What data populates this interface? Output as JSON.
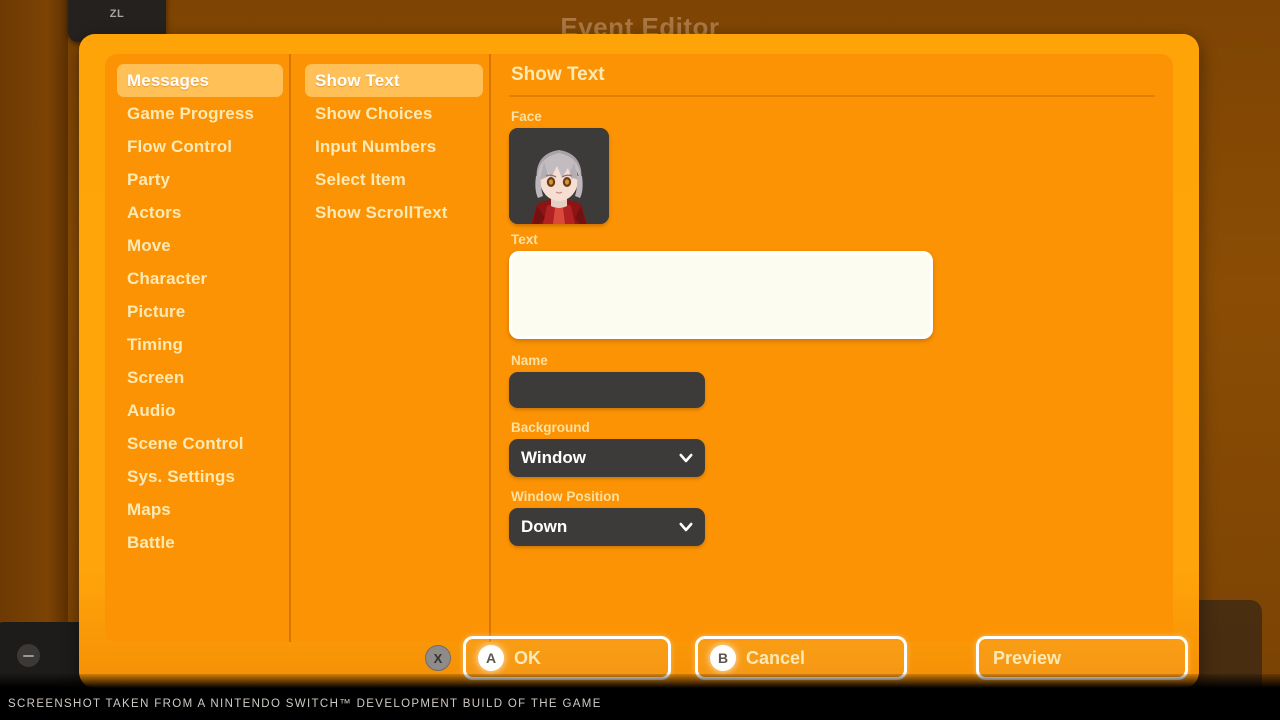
{
  "background": {
    "editor_title": "Event Editor",
    "tab_label": "ZL",
    "minimize_icon": "minus-icon"
  },
  "dialog": {
    "categories": {
      "selected": "Messages",
      "items": [
        {
          "label": "Messages"
        },
        {
          "label": "Game Progress"
        },
        {
          "label": "Flow Control"
        },
        {
          "label": "Party"
        },
        {
          "label": "Actors"
        },
        {
          "label": "Move"
        },
        {
          "label": "Character"
        },
        {
          "label": "Picture"
        },
        {
          "label": "Timing"
        },
        {
          "label": "Screen"
        },
        {
          "label": "Audio"
        },
        {
          "label": "Scene Control"
        },
        {
          "label": "Sys. Settings"
        },
        {
          "label": "Maps"
        },
        {
          "label": "Battle"
        }
      ]
    },
    "commands": {
      "selected": "Show Text",
      "items": [
        {
          "label": "Show Text"
        },
        {
          "label": "Show Choices"
        },
        {
          "label": "Input Numbers"
        },
        {
          "label": "Select Item"
        },
        {
          "label": "Show ScrollText"
        }
      ]
    },
    "detail": {
      "title": "Show Text",
      "face": {
        "label": "Face",
        "icon": "character-portrait"
      },
      "text": {
        "label": "Text",
        "value": "",
        "placeholder": ""
      },
      "name": {
        "label": "Name",
        "value": "",
        "placeholder": ""
      },
      "background": {
        "label": "Background",
        "value": "Window",
        "chevron": "chevron-down-icon"
      },
      "window_position": {
        "label": "Window Position",
        "value": "Down",
        "chevron": "chevron-down-icon"
      }
    },
    "footer": {
      "x_badge": "X",
      "ok": {
        "badge": "A",
        "label": "OK"
      },
      "cancel": {
        "badge": "B",
        "label": "Cancel"
      },
      "preview": {
        "label": "Preview"
      }
    }
  },
  "caption": {
    "text": "SCREENSHOT TAKEN FROM A NINTENDO SWITCH™ DEVELOPMENT BUILD OF THE GAME"
  },
  "colors": {
    "dialog_bg": "#ffa408",
    "panel_bg": "#fb9304",
    "accent_selected": "#ffc157",
    "label_text": "#fde0a0",
    "input_dark": "#3d3b3a",
    "textarea_bg": "#fdfcf0"
  }
}
